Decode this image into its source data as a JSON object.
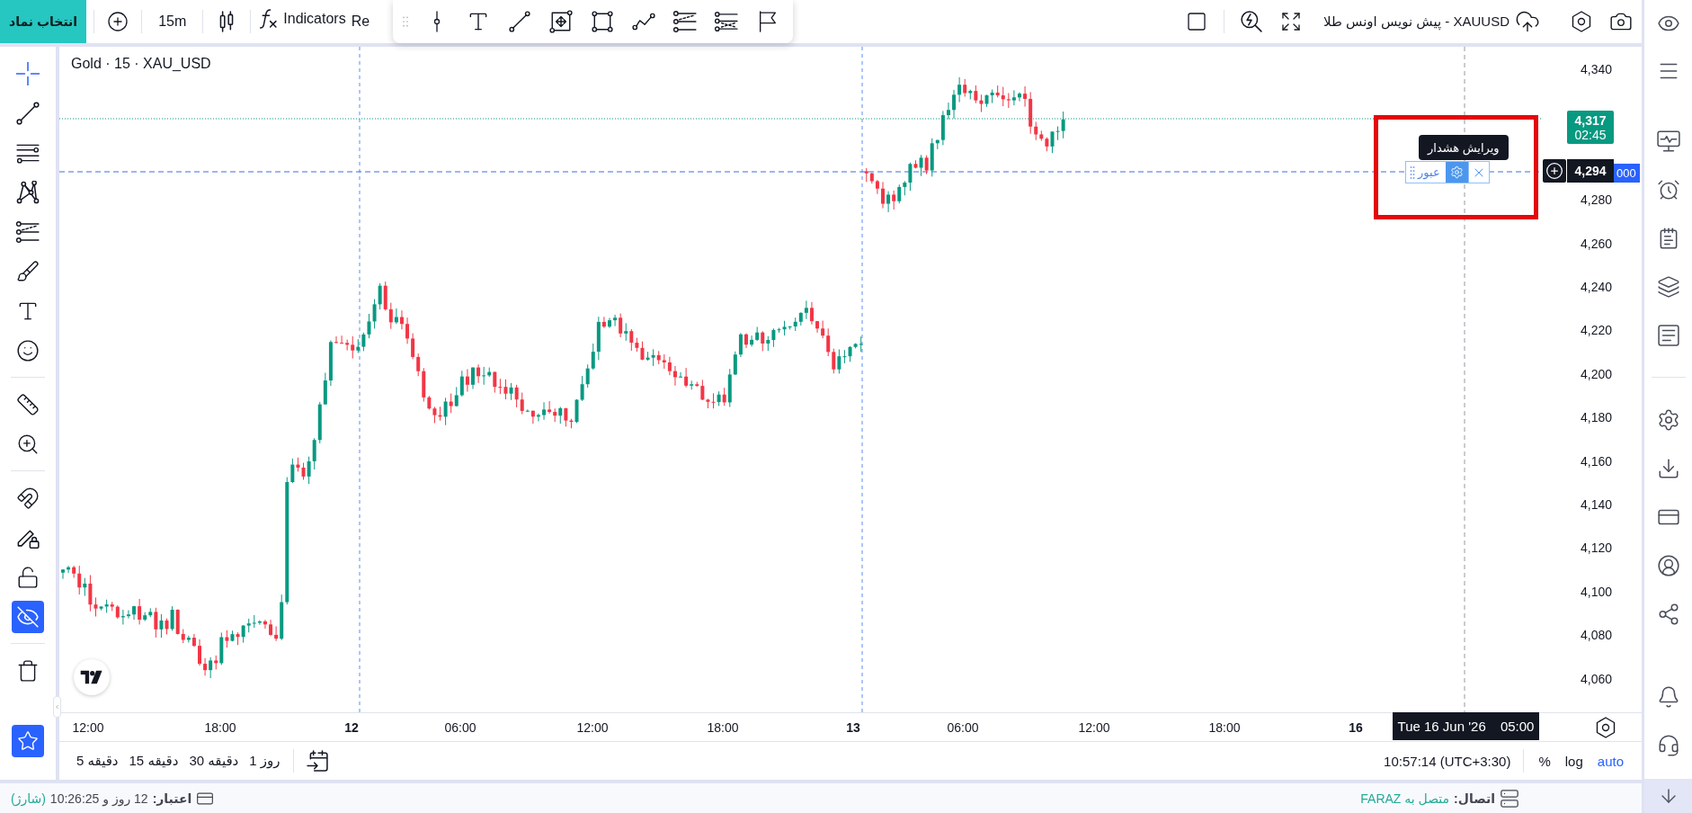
{
  "top_bar": {
    "symbol_button": "انتخاب نماد",
    "interval": "15m",
    "indicators": "Indicators",
    "cut_off_button": "Re",
    "title": "XAUUSD - پیش نویس اونس طلا"
  },
  "left_toolbar": {
    "tools": [
      {
        "selected": true
      },
      {
        "selected": false
      },
      {
        "selected": false
      },
      {
        "selected": false
      },
      {
        "selected": false
      },
      {
        "selected": false
      },
      {
        "selected": false
      },
      {
        "selected": false
      },
      {
        "selected": false
      },
      {
        "selected": false
      }
    ],
    "toggles": [
      {
        "on": false
      },
      {
        "on": false
      },
      {
        "on": false
      },
      {
        "on": true
      }
    ],
    "favorites_on": true
  },
  "chart": {
    "legend": "Gold · 15 · XAU_USD",
    "alert": {
      "label": "عبور",
      "tooltip": "ویرایش هشدار",
      "settings_hovered": true
    }
  },
  "price_axis": {
    "labels": [
      "4,340",
      "4,280",
      "4,260",
      "4,240",
      "4,220",
      "4,200",
      "4,180",
      "4,160",
      "4,140",
      "4,120",
      "4,100",
      "4,080",
      "4,060"
    ],
    "last_price": {
      "price": "4,317",
      "countdown": "02:45"
    },
    "crosshair_price": "4,294",
    "alert_price": "000"
  },
  "time_axis": {
    "labels": [
      {
        "text": "12:00",
        "kind": "time"
      },
      {
        "text": "18:00",
        "kind": "time"
      },
      {
        "text": "12",
        "kind": "day"
      },
      {
        "text": "06:00",
        "kind": "time"
      },
      {
        "text": "12:00",
        "kind": "time"
      },
      {
        "text": "18:00",
        "kind": "time"
      },
      {
        "text": "13",
        "kind": "day"
      },
      {
        "text": "06:00",
        "kind": "time"
      },
      {
        "text": "12:00",
        "kind": "time"
      },
      {
        "text": "18:00",
        "kind": "time"
      },
      {
        "text": "16",
        "kind": "day"
      }
    ],
    "crosshair": {
      "date": "Tue 16 Jun '26",
      "time": "05:00"
    }
  },
  "bottom_toolbar": {
    "ranges": [
      "1 روز",
      "30 دقیقه",
      "15 دقیقه",
      "5 دقیقه"
    ],
    "clock": "10:57:14 (UTC+3:30)",
    "scale_buttons": [
      {
        "label": "%",
        "on": false
      },
      {
        "label": "log",
        "on": false
      },
      {
        "label": "auto",
        "on": true
      }
    ]
  },
  "status_bar": {
    "credit_label": "اعتبار:",
    "credit_value": "12 روز و 10:26:25",
    "charge_link": "(شارژ)",
    "connection_label": "اتصال:",
    "connection_value": "متصل به FARAZ"
  }
}
